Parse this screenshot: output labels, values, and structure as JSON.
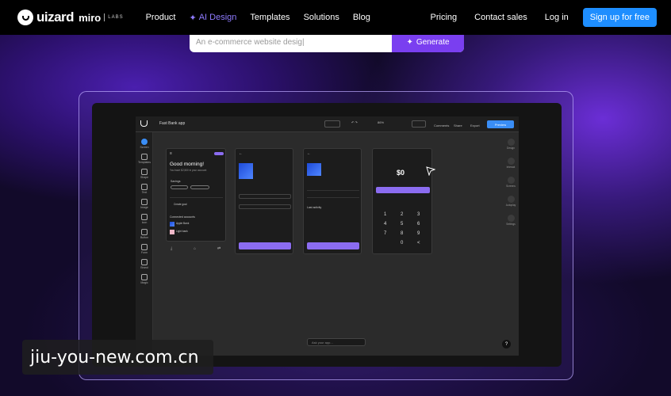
{
  "nav": {
    "logo_text": "uizard",
    "miro": "miro",
    "labs": "LABS",
    "links": [
      "Product",
      "AI Design",
      "Templates",
      "Solutions",
      "Blog"
    ],
    "right_links": [
      "Pricing",
      "Contact sales",
      "Log in"
    ],
    "signup": "Sign up for free"
  },
  "prompt": {
    "placeholder": "An e-commerce website desig|",
    "generate": "Generate"
  },
  "app": {
    "title": "Fast Bank app",
    "zoom": "86%",
    "top_actions": [
      "Comments",
      "Share",
      "Export"
    ],
    "preview": "Preview",
    "sidebar": [
      "Screen",
      "Templates",
      "Shape",
      "Text",
      "Image",
      "Icon",
      "Button",
      "Form",
      "Brand",
      "Magic"
    ],
    "rightbar": [
      "Design",
      "Interact",
      "Screens",
      "Autoplay",
      "Settings"
    ],
    "screen1": {
      "greeting": "Good morning!",
      "sub": "You have $2,500 in your account",
      "savings": "Savings",
      "add_goal": "Create goal",
      "connected": "Connected accounts",
      "acc1": "Apple Bank",
      "acc2": "Light bank"
    },
    "screen3": {
      "activity": "Last activity"
    },
    "screen4": {
      "amount": "$0",
      "keys": [
        "1",
        "2",
        "3",
        "4",
        "5",
        "6",
        "7",
        "8",
        "9",
        "",
        "0",
        "<"
      ]
    },
    "bottom_input": "Ask your app...",
    "help": "?"
  },
  "watermark": "jiu-you-new.com.cn"
}
